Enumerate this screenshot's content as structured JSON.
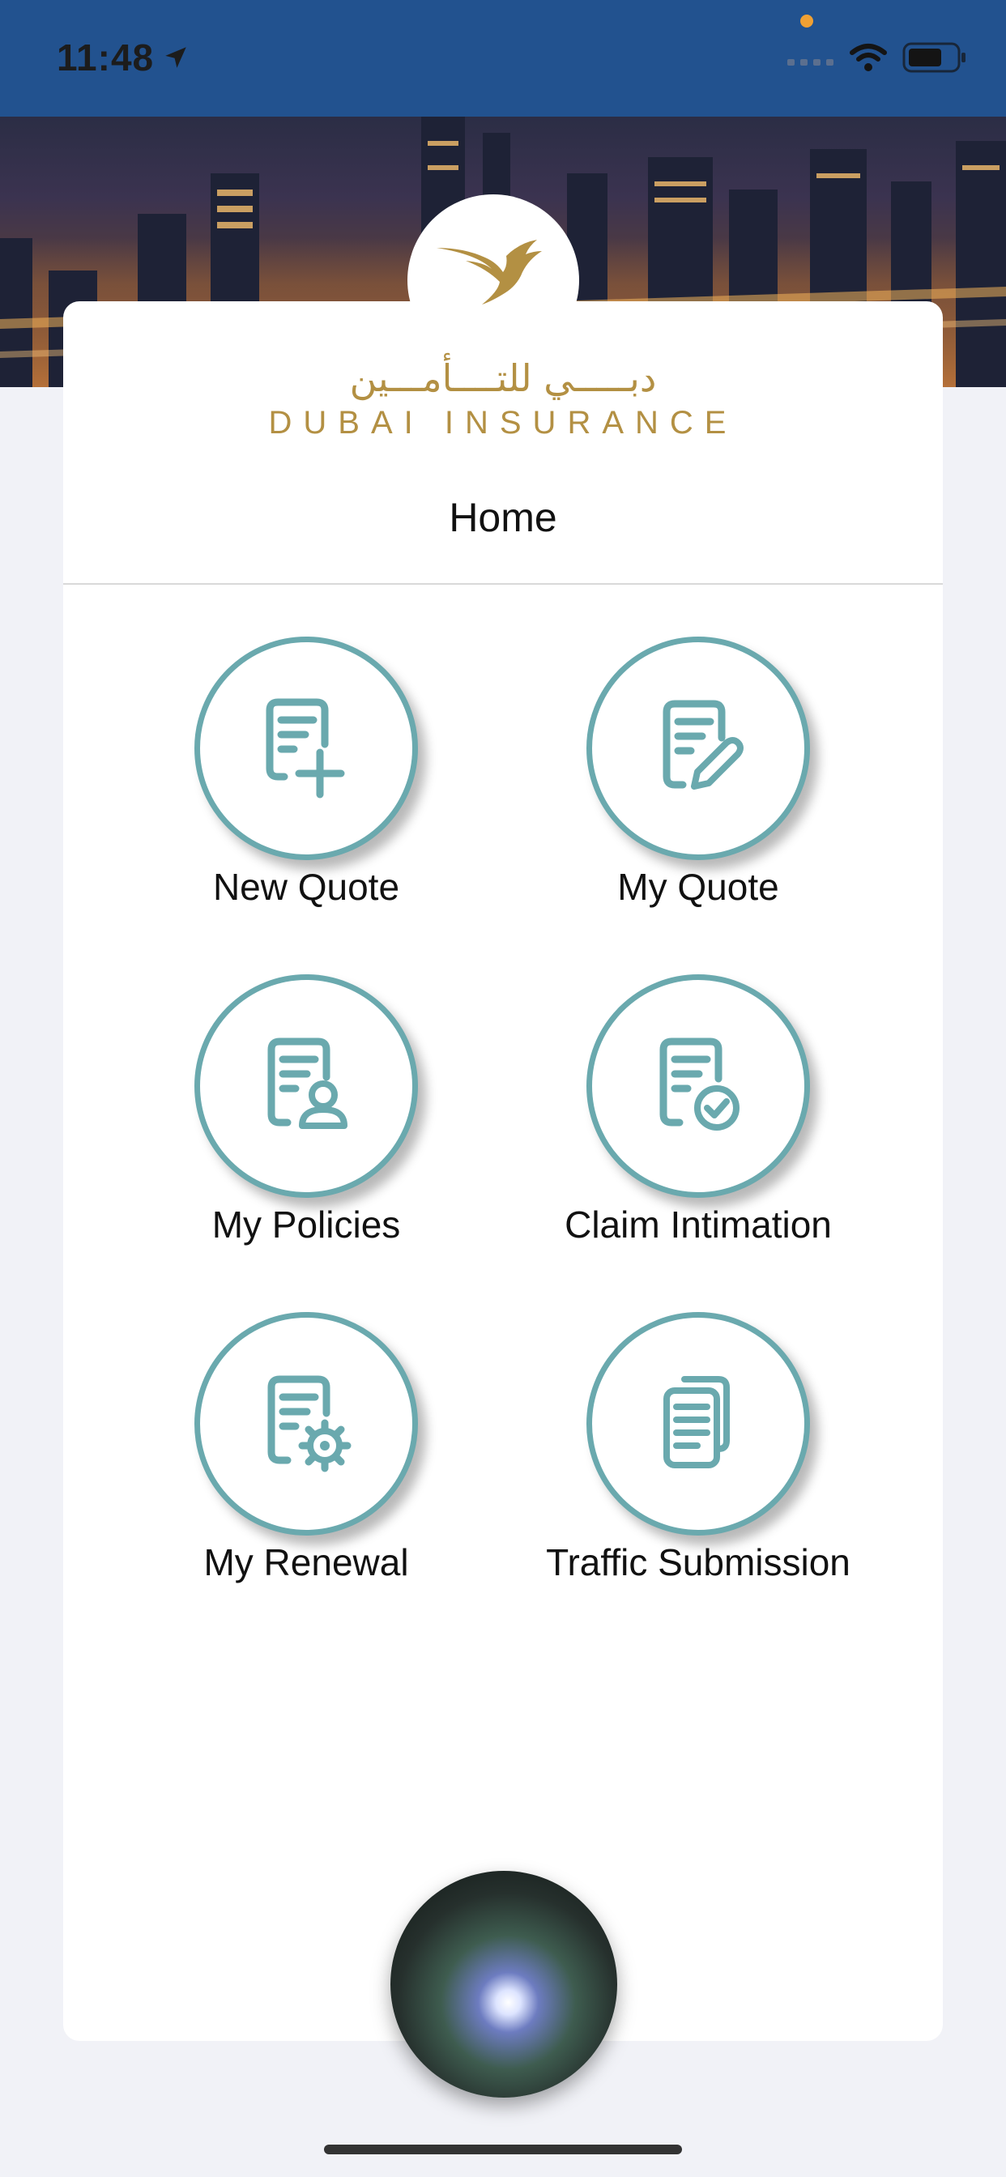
{
  "status_bar": {
    "time": "11:48",
    "icons": [
      "location-arrow-icon",
      "signal-icon",
      "wifi-icon",
      "battery-icon"
    ]
  },
  "brand": {
    "arabic_name": "دبـــــي للتــــأمـــين",
    "english_name": "DUBAI INSURANCE",
    "gold_color": "#b39043"
  },
  "page": {
    "title": "Home"
  },
  "menu": [
    {
      "label": "New Quote",
      "icon": "document-add-icon"
    },
    {
      "label": "My Quote",
      "icon": "document-edit-icon"
    },
    {
      "label": "My Policies",
      "icon": "document-user-icon"
    },
    {
      "label": "Claim Intimation",
      "icon": "document-check-icon"
    },
    {
      "label": "My Renewal",
      "icon": "document-settings-icon"
    },
    {
      "label": "Traffic Submission",
      "icon": "documents-stack-icon"
    }
  ],
  "colors": {
    "header_blue": "#22528f",
    "teal_accent": "#6aa9ae",
    "background": "#f1f2f7"
  }
}
